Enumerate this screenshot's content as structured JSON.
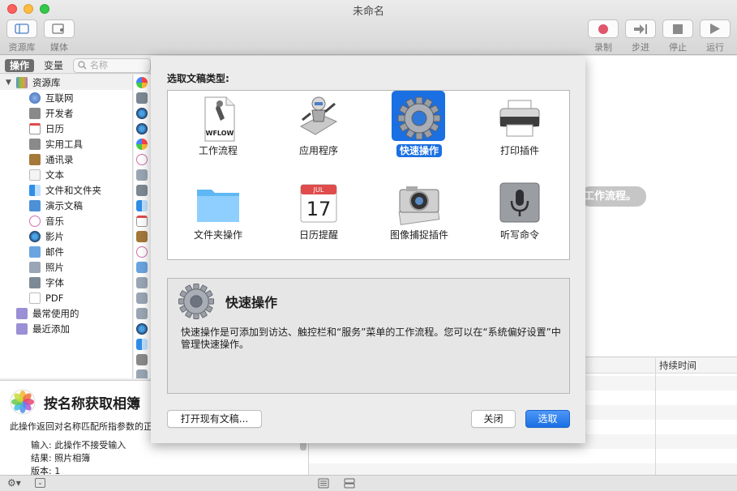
{
  "window": {
    "title": "未命名"
  },
  "toolbar": {
    "left": [
      {
        "label": "资源库",
        "icon": "sidebar-toggle-icon"
      },
      {
        "label": "媒体",
        "icon": "media-icon"
      }
    ],
    "right": [
      {
        "label": "录制",
        "icon": "record-icon"
      },
      {
        "label": "步进",
        "icon": "step-icon"
      },
      {
        "label": "停止",
        "icon": "stop-icon"
      },
      {
        "label": "运行",
        "icon": "run-icon"
      }
    ]
  },
  "library": {
    "tabs": [
      "操作",
      "变量"
    ],
    "search_placeholder": "名称",
    "root": "资源库",
    "items": [
      "互联网",
      "开发者",
      "日历",
      "实用工具",
      "通讯录",
      "文本",
      "文件和文件夹",
      "演示文稿",
      "音乐",
      "影片",
      "邮件",
      "照片",
      "字体",
      "PDF"
    ],
    "groups": [
      "最常使用的",
      "最近添加"
    ]
  },
  "description": {
    "title": "按名称获取相簿",
    "text": "此操作返回对名称匹配所指参数的正",
    "input_label": "输入:",
    "input_value": "此操作不接受输入",
    "result_label": "结果:",
    "result_value": "照片相簿",
    "version_label": "版本:",
    "version_value": "1"
  },
  "workflow": {
    "hint": "工作流程。",
    "log_column": "持续时间"
  },
  "sheet": {
    "heading": "选取文稿类型:",
    "types": [
      {
        "label": "工作流程",
        "icon": "workflow-icon"
      },
      {
        "label": "应用程序",
        "icon": "application-robot-icon"
      },
      {
        "label": "快速操作",
        "icon": "gear-icon",
        "selected": true
      },
      {
        "label": "打印插件",
        "icon": "printer-icon"
      },
      {
        "label": "文件夹操作",
        "icon": "folder-icon"
      },
      {
        "label": "日历提醒",
        "icon": "calendar-icon"
      },
      {
        "label": "图像捕捉插件",
        "icon": "camera-icon"
      },
      {
        "label": "听写命令",
        "icon": "microphone-icon"
      }
    ],
    "calendar_month": "JUL",
    "calendar_day": "17",
    "workflow_file_tag": "WFLOW",
    "detail_title": "快速操作",
    "detail_text": "快速操作是可添加到访达、触控栏和“服务”菜单的工作流程。您可以在“系统偏好设置”中管理快速操作。",
    "open_existing": "打开现有文稿...",
    "close": "关闭",
    "choose": "选取"
  },
  "colors": {
    "accent": "#1a6fe3",
    "record": "#e0566b"
  }
}
